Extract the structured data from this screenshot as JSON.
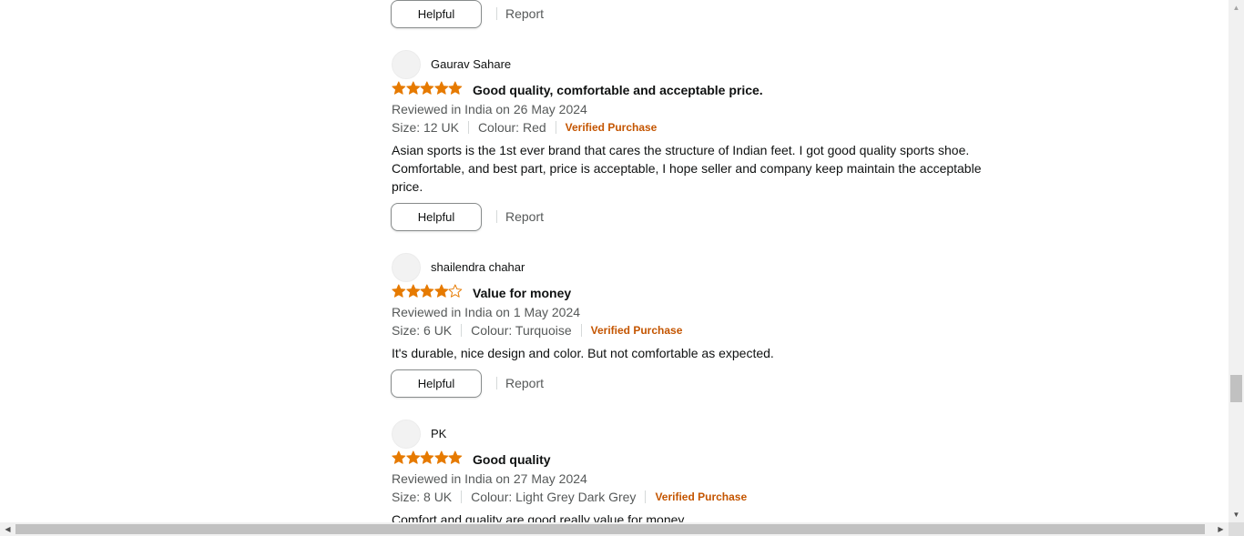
{
  "actions": {
    "helpful_label": "Helpful",
    "report_label": "Report"
  },
  "colors": {
    "star_fill": "#e67a00",
    "verified": "#c45500"
  },
  "reviews": [
    {
      "reviewer": "Gaurav Sahare",
      "rating": 5,
      "title": "Good quality, comfortable and acceptable price.",
      "date": "Reviewed in India on 26 May 2024",
      "size": "Size: 12 UK",
      "colour": "Colour: Red",
      "verified": "Verified Purchase",
      "body": "Asian sports is the 1st ever brand that cares the structure of Indian feet. I got good quality sports shoe. Comfortable, and best part, price is acceptable, I hope seller and company keep maintain the acceptable price."
    },
    {
      "reviewer": "shailendra chahar",
      "rating": 4,
      "title": "Value for money",
      "date": "Reviewed in India on 1 May 2024",
      "size": "Size: 6 UK",
      "colour": "Colour: Turquoise",
      "verified": "Verified Purchase",
      "body": "It's durable, nice design and color. But not comfortable as expected."
    },
    {
      "reviewer": "PK",
      "rating": 5,
      "title": "Good quality",
      "date": "Reviewed in India on 27 May 2024",
      "size": "Size: 8 UK",
      "colour": "Colour: Light Grey Dark Grey",
      "verified": "Verified Purchase",
      "body": "Comfort and quality are good really value for money"
    }
  ]
}
